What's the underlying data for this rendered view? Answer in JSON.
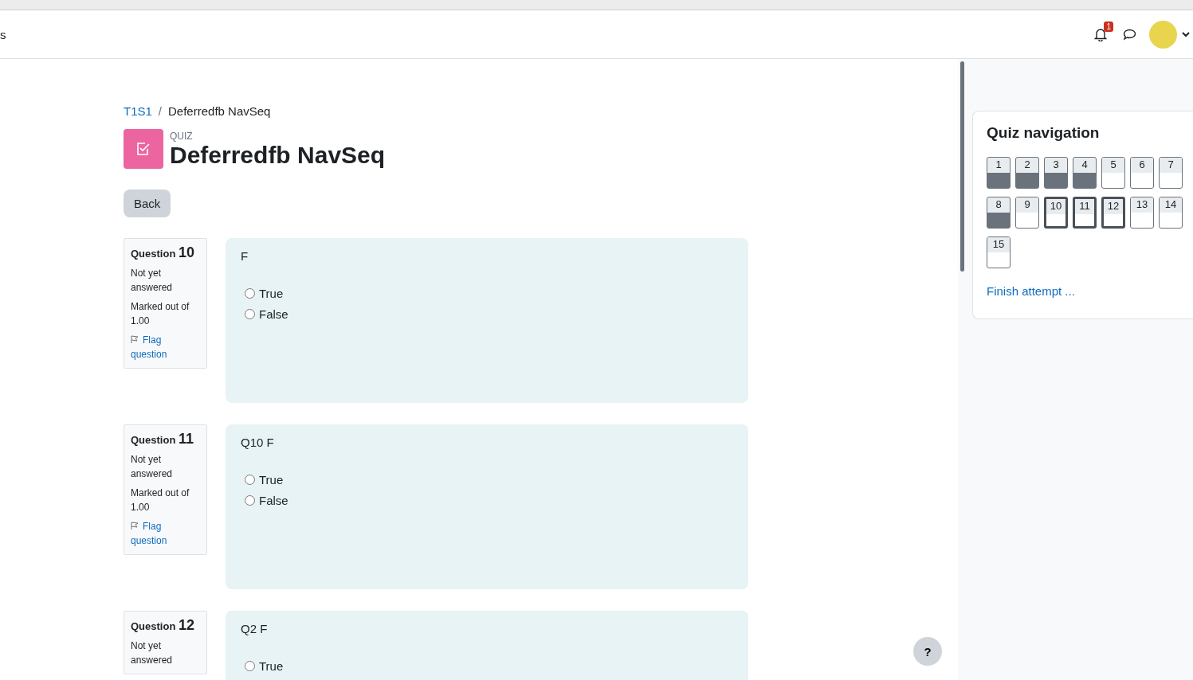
{
  "header": {
    "site_fragment": "s",
    "notifications": {
      "count": "1"
    }
  },
  "breadcrumb": {
    "separator": "/",
    "items": [
      {
        "label": "T1S1",
        "link": true
      },
      {
        "label": "Deferredfb NavSeq",
        "link": false
      }
    ]
  },
  "activity": {
    "type": "QUIZ",
    "title": "Deferredfb NavSeq"
  },
  "back_button": "Back",
  "questions": [
    {
      "label": "Question",
      "number": "10",
      "state": "Not yet answered",
      "mark": "Marked out of 1.00",
      "flag": "Flag question",
      "text": "F",
      "options": [
        {
          "label": "True",
          "selected": false
        },
        {
          "label": "False",
          "selected": false
        }
      ]
    },
    {
      "label": "Question",
      "number": "11",
      "state": "Not yet answered",
      "mark": "Marked out of 1.00",
      "flag": "Flag question",
      "text": "Q10 F",
      "options": [
        {
          "label": "True",
          "selected": false
        },
        {
          "label": "False",
          "selected": false
        }
      ]
    },
    {
      "label": "Question",
      "number": "12",
      "state": "Not yet answered",
      "text": "Q2 F",
      "options": [
        {
          "label": "True",
          "selected": false
        }
      ]
    }
  ],
  "quiz_navigation": {
    "title": "Quiz navigation",
    "buttons": [
      {
        "label": "1",
        "answered": true,
        "current": false
      },
      {
        "label": "2",
        "answered": true,
        "current": false
      },
      {
        "label": "3",
        "answered": true,
        "current": false
      },
      {
        "label": "4",
        "answered": true,
        "current": false
      },
      {
        "label": "5",
        "answered": false,
        "current": false
      },
      {
        "label": "6",
        "answered": false,
        "current": false
      },
      {
        "label": "7",
        "answered": false,
        "current": false
      },
      {
        "label": "8",
        "answered": true,
        "current": false
      },
      {
        "label": "9",
        "answered": false,
        "current": false
      },
      {
        "label": "10",
        "answered": false,
        "current": true
      },
      {
        "label": "11",
        "answered": false,
        "current": true
      },
      {
        "label": "12",
        "answered": false,
        "current": true
      },
      {
        "label": "13",
        "answered": false,
        "current": false
      },
      {
        "label": "14",
        "answered": false,
        "current": false
      },
      {
        "label": "15",
        "answered": false,
        "current": false
      }
    ],
    "finish_link": "Finish attempt ..."
  },
  "help_button": "?"
}
